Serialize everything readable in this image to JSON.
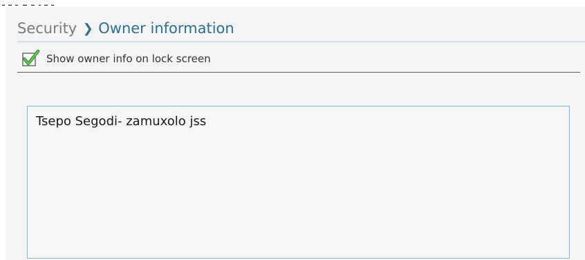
{
  "breadcrumb": {
    "parent": "Security",
    "separator_icon": "chevron-right-icon",
    "current": "Owner information"
  },
  "options": {
    "show_owner_info": {
      "label": "Show owner info on lock screen",
      "checked": true,
      "icon": "checkmark-icon"
    }
  },
  "owner_info": {
    "text": "Tsepo Segodi- zamuxolo jss"
  },
  "colors": {
    "accent": "#2a6f97",
    "check_green": "#3aa635",
    "field_border": "#7fb6d7",
    "background": "#f4f4f4"
  }
}
